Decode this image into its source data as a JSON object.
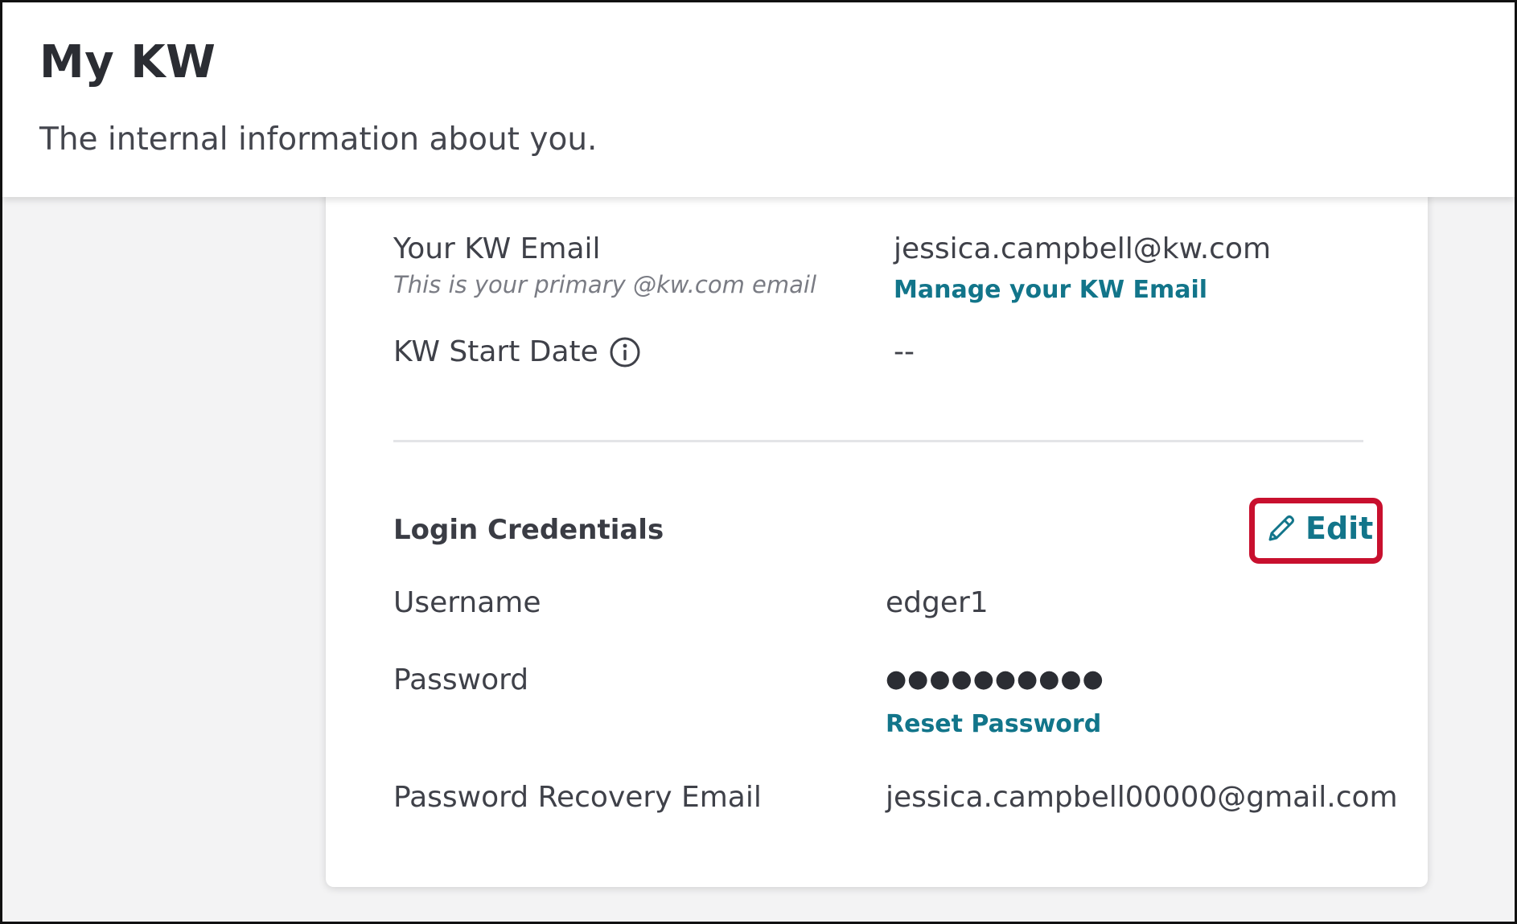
{
  "header": {
    "title": "My KW",
    "subtitle": "The internal information about you."
  },
  "kw_email": {
    "label": "Your KW Email",
    "hint": "This is your primary @kw.com email",
    "value": "jessica.campbell@kw.com",
    "manage_link": "Manage your KW Email"
  },
  "start_date": {
    "label": "KW Start Date",
    "value": "--"
  },
  "credentials": {
    "title": "Login Credentials",
    "edit_label": "Edit",
    "username_label": "Username",
    "username_value": "edger1",
    "password_label": "Password",
    "password_value": "●●●●●●●●●●",
    "reset_link": "Reset Password",
    "recovery_label": "Password Recovery Email",
    "recovery_value": "jessica.campbell00000@gmail.com"
  },
  "colors": {
    "link": "#12758a",
    "highlight": "#c8102e",
    "text": "#3f4149"
  },
  "icons": {
    "start_date_info": "info-icon",
    "edit": "pencil-icon"
  }
}
